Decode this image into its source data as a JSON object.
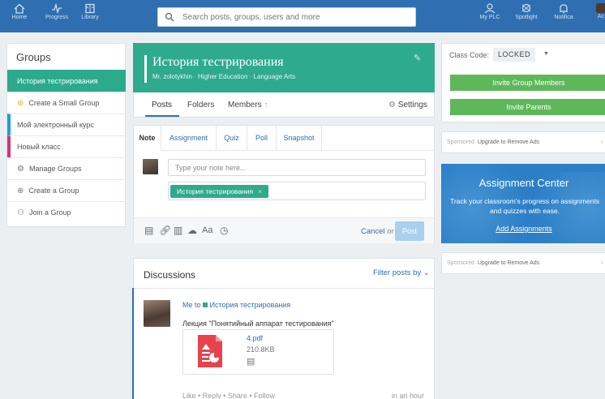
{
  "topnav": {
    "left": [
      {
        "label": "Home",
        "icon": "home-icon"
      },
      {
        "label": "Progress",
        "icon": "progress-icon"
      },
      {
        "label": "Library",
        "icon": "library-icon"
      }
    ],
    "right": [
      {
        "label": "My PLC",
        "icon": "plc-icon"
      },
      {
        "label": "Spotlight",
        "icon": "spotlight-icon"
      },
      {
        "label": "Notifica",
        "icon": "bell-icon"
      },
      {
        "label": "Ac",
        "icon": "avatar"
      }
    ],
    "search_placeholder": "Search posts, groups, users and more",
    "bar_color": "#2f6fb1"
  },
  "sidebar": {
    "title": "Groups",
    "items": [
      {
        "label": "История тестрирования",
        "active": true
      },
      {
        "label": "Create a Small Group",
        "icon": "plus-circle-icon"
      },
      {
        "label": "Мой электронный курс",
        "color": "#1e9fd6"
      },
      {
        "label": "Новый класс",
        "color": "#d6317a"
      },
      {
        "label": "Manage Groups",
        "icon": "gear-icon"
      },
      {
        "label": "Create a Group",
        "icon": "plus-circle-icon"
      },
      {
        "label": "Join a Group",
        "icon": "users-icon"
      }
    ]
  },
  "group": {
    "title": "История тестрирования",
    "subtitle": "Mr. zolotykhin · Higher Education · Language Arts",
    "color": "#2eaa8d",
    "tabs": {
      "posts": "Posts",
      "folders": "Folders",
      "members": "Members",
      "members_suffix": "↑",
      "settings": "Settings"
    }
  },
  "composer": {
    "tabs": [
      "Note",
      "Assignment",
      "Quiz",
      "Poll",
      "Snapshot"
    ],
    "note_placeholder": "Type your note here...",
    "recipient": "История тестрирования",
    "recipient_remove": "×",
    "format_label": "Aa",
    "cancel": "Cancel",
    "or": "or",
    "post": "Post"
  },
  "discussions": {
    "title": "Discussions",
    "filter": "Filter posts by",
    "posts": [
      {
        "author": "Me",
        "to": "to",
        "group": "История тестрирования",
        "text": "Лекция \"Понятийный аппарат тестирования\"",
        "attachment": {
          "name": "4.pdf",
          "size": "210.8KB"
        },
        "actions": "Like  •  Reply  •  Share  •  Follow",
        "time": "in an hour"
      }
    ]
  },
  "rightcol": {
    "class_code_label": "Class Code:",
    "class_code": "LOCKED",
    "invite_members": "Invite Group Members",
    "invite_parents": "Invite Parents",
    "sponsored": "Sponsored",
    "remove_ads": "Upgrade to Remove Ads",
    "assignment_center": {
      "title": "Assignment Center",
      "text": "Track your classroom's progress on assignments and quizzes with ease.",
      "link": "Add Assignments"
    }
  }
}
